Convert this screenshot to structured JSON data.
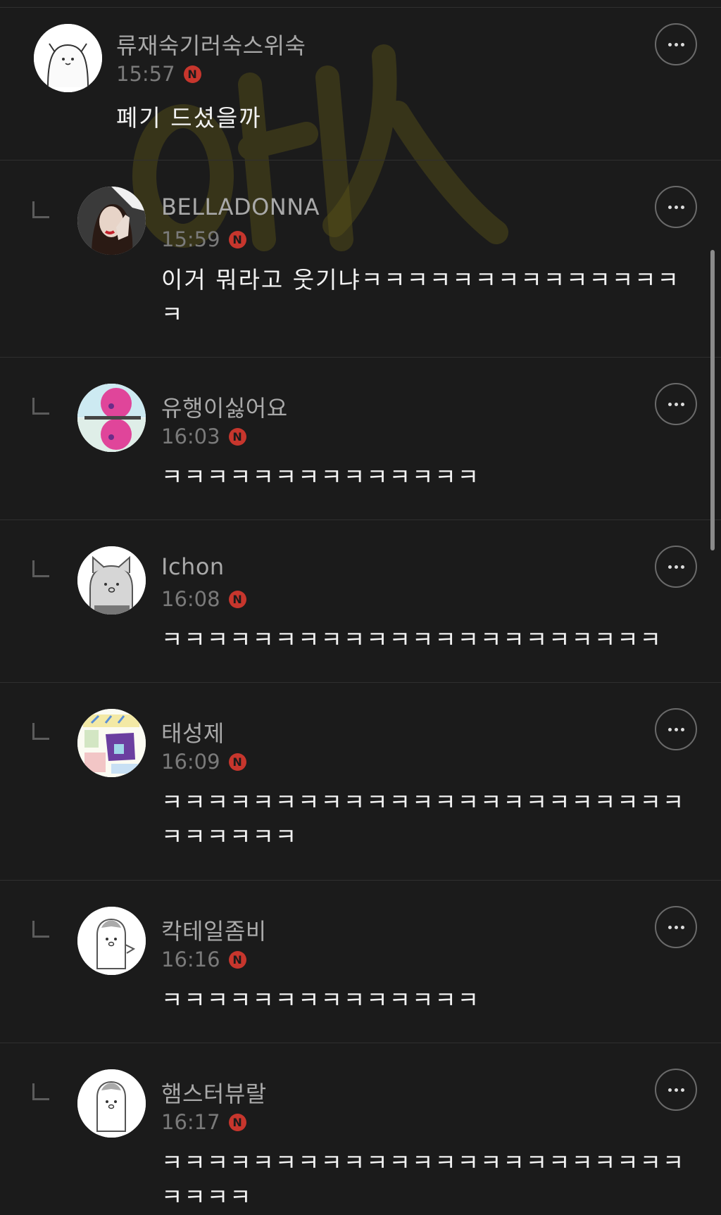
{
  "comments": [
    {
      "author": "류재숙기러숙스위숙",
      "time": "15:57",
      "badge": "N",
      "text": "폐기 드셨을까",
      "is_reply": false
    },
    {
      "author": "BELLADONNA",
      "time": "15:59",
      "badge": "N",
      "text": "이거 뭐라고 웃기냐ㅋㅋㅋㅋㅋㅋㅋㅋㅋㅋㅋㅋㅋㅋㅋ",
      "is_reply": true
    },
    {
      "author": "유행이싫어요",
      "time": "16:03",
      "badge": "N",
      "text": "ㅋㅋㅋㅋㅋㅋㅋㅋㅋㅋㅋㅋㅋㅋ",
      "is_reply": true
    },
    {
      "author": "Ichon",
      "time": "16:08",
      "badge": "N",
      "text": "ㅋㅋㅋㅋㅋㅋㅋㅋㅋㅋㅋㅋㅋㅋㅋㅋㅋㅋㅋㅋㅋㅋ",
      "is_reply": true
    },
    {
      "author": "태성제",
      "time": "16:09",
      "badge": "N",
      "text": "ㅋㅋㅋㅋㅋㅋㅋㅋㅋㅋㅋㅋㅋㅋㅋㅋㅋㅋㅋㅋㅋㅋㅋㅋㅋㅋㅋㅋㅋ",
      "is_reply": true
    },
    {
      "author": "칵테일좀비",
      "time": "16:16",
      "badge": "N",
      "text": "ㅋㅋㅋㅋㅋㅋㅋㅋㅋㅋㅋㅋㅋㅋ",
      "is_reply": true
    },
    {
      "author": "햄스터뷰랄",
      "time": "16:17",
      "badge": "N",
      "text": "ㅋㅋㅋㅋㅋㅋㅋㅋㅋㅋㅋㅋㅋㅋㅋㅋㅋㅋㅋㅋㅋㅋㅋㅋㅋㅋㅋ",
      "is_reply": true
    }
  ],
  "icons": {
    "more": "more-horizontal-icon",
    "reply": "reply-arrow-icon",
    "badge": "new-badge-icon"
  },
  "colors": {
    "background": "#1b1b1b",
    "author": "#a9a9a9",
    "time": "#7a7a7a",
    "badge": "#c7362d",
    "divider": "#2f2f2f"
  }
}
